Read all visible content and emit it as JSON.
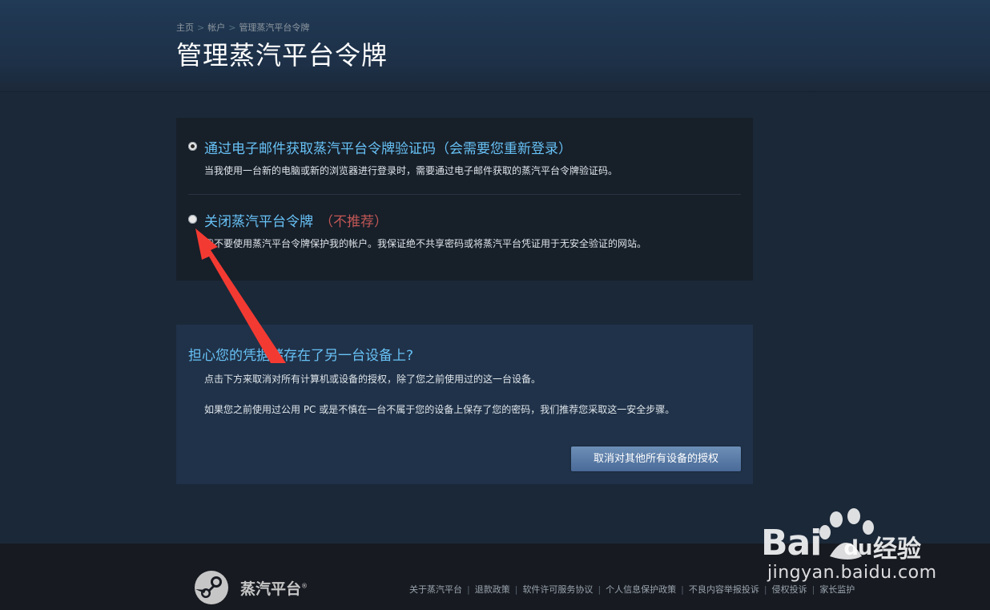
{
  "breadcrumb": {
    "home": "主页",
    "account": "帐户",
    "current": "管理蒸汽平台令牌",
    "separator": ">"
  },
  "page_title": "管理蒸汽平台令牌",
  "options": [
    {
      "title": "通过电子邮件获取蒸汽平台令牌验证码（会需要您重新登录）",
      "warning": "",
      "description": "当我使用一台新的电脑或新的浏览器进行登录时，需要通过电子邮件获取的蒸汽平台令牌验证码。",
      "checked": true
    },
    {
      "title": "关闭蒸汽平台令牌",
      "warning": "（不推荐）",
      "description": "我不要使用蒸汽平台令牌保护我的帐户。我保证绝不共享密码或将蒸汽平台凭证用于无安全验证的网站。",
      "checked": false
    }
  ],
  "device_section": {
    "title": "担心您的凭据储存在了另一台设备上?",
    "paragraph1": "点击下方来取消对所有计算机或设备的授权，除了您之前使用过的这一台设备。",
    "paragraph2": "如果您之前使用过公用 PC 或是不慎在一台不属于您的设备上保存了您的密码，我们推荐您采取这一安全步骤。",
    "button_label": "取消对其他所有设备的授权"
  },
  "footer": {
    "brand": "蒸汽平台",
    "registered": "®",
    "links": [
      "关于蒸汽平台",
      "退款政策",
      "软件许可服务协议",
      "个人信息保护政策",
      "不良内容举报投诉",
      "侵权投诉",
      "家长监护"
    ]
  },
  "watermark": {
    "bai": "Bai",
    "du": "du",
    "brand": "经验",
    "url": "jingyan.baidu.com"
  },
  "colors": {
    "link_blue": "#67c1f5",
    "warning_red": "#c15755",
    "annotation_arrow": "#f33a32"
  }
}
